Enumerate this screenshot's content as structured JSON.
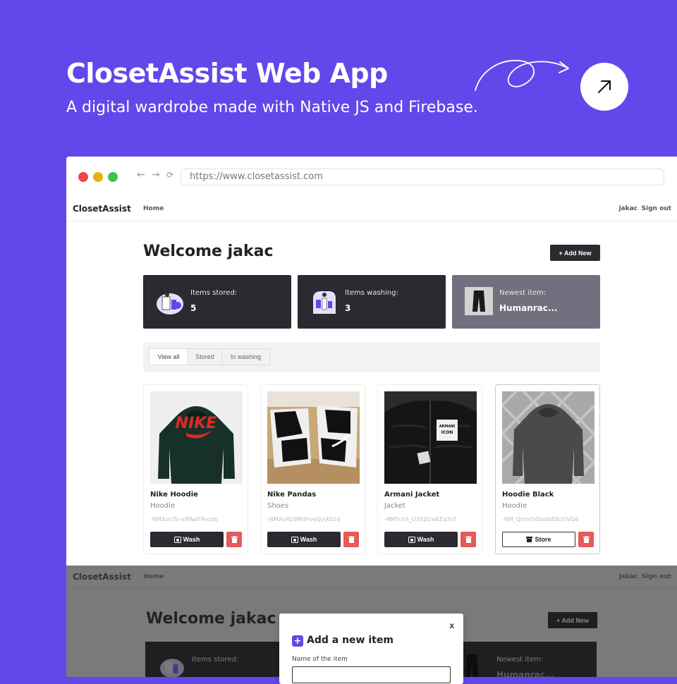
{
  "hero": {
    "title": "ClosetAssist Web App",
    "subtitle": "A digital wardrobe made with Native JS and Firebase."
  },
  "browser": {
    "url": "https://www.closetassist.com"
  },
  "nav": {
    "brand": "ClosetAssist",
    "home": "Home",
    "user": "jakac",
    "signout": "Sign out"
  },
  "main": {
    "welcome": "Welcome jakac",
    "add_new": "+ Add New"
  },
  "stats": [
    {
      "label": "Items stored:",
      "value": "5"
    },
    {
      "label": "Items washing:",
      "value": "3"
    },
    {
      "label": "Newest item:",
      "value": "Humanrac..."
    }
  ],
  "filters": [
    "View all",
    "Stored",
    "In washing"
  ],
  "items": [
    {
      "name": "Nike Hoodie",
      "category": "Hoodie",
      "id": "-NMXuOTu-xlPAwFRvcds",
      "action": "Wash"
    },
    {
      "name": "Nike Pandas",
      "category": "Shoes",
      "id": "-NMXuRpSMUhveQyiX02d",
      "action": "Wash"
    },
    {
      "name": "Armani Jacket",
      "category": "Jacket",
      "id": "-NMYckh_O3SD2wKEq3sT",
      "action": "Wash"
    },
    {
      "name": "Hoodie Black",
      "category": "Hoodie",
      "id": "-NM_QmoYxDodbBXoUVG8",
      "action": "Store"
    }
  ],
  "photo_text": {
    "nike_logo": "NIKE",
    "tag_line1": "ARMANI",
    "tag_line2": "ICON"
  },
  "modal": {
    "close": "x",
    "title": "Add a new item",
    "name_label": "Name of the item"
  },
  "colors": {
    "background": "#6247EA",
    "dark_card": "#2A2A30",
    "newest_card": "#71707F",
    "delete": "#E55A57"
  }
}
